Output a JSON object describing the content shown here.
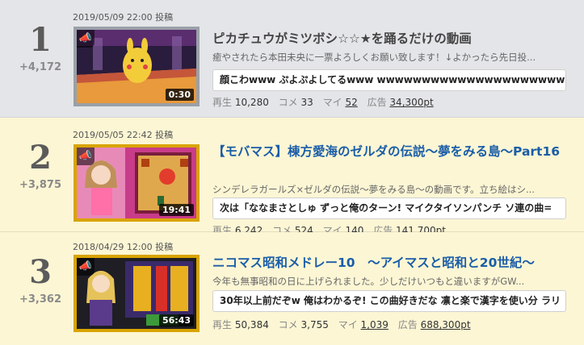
{
  "items": [
    {
      "rank": "1",
      "gain": "+4,172",
      "posted": "2019/05/09 22:00 投稿",
      "duration": "0:30",
      "title": "ピカチュウがミツボシ☆☆★を踊るだけの動画",
      "description": "癒やされたら本田未央に一票よろしくお願い致します！↓よかったら先日投...",
      "comment": "顔こわwww ぷよぷよしてるwww wwwwwwwwwwwwwwwwwwwwww",
      "stats": {
        "views_label": "再生",
        "views": "10,280",
        "comments_label": "コメ",
        "comments": "33",
        "mylist_label": "マイ",
        "mylist": "52",
        "ads_label": "広告",
        "ads": "34,300pt"
      }
    },
    {
      "rank": "2",
      "gain": "+3,875",
      "posted": "2019/05/05 22:42 投稿",
      "duration": "19:41",
      "title": "【モバマス】棟方愛海のゼルダの伝説～夢をみる島～Part16",
      "description": "シンデレラガールズ×ゼルダの伝説～夢をみる島～の動画です。立ち絵はシ...",
      "comment": "次は「ななまさとしゅ ずっと俺のターン! マイクタイソンパンチ ソ連の曲=",
      "stats": {
        "views_label": "再生",
        "views": "6,242",
        "comments_label": "コメ",
        "comments": "524",
        "mylist_label": "マイ",
        "mylist": "140",
        "ads_label": "広告",
        "ads": "141,700pt"
      }
    },
    {
      "rank": "3",
      "gain": "+3,362",
      "posted": "2018/04/29 12:00 投稿",
      "duration": "56:43",
      "title": "ニコマス昭和メドレー10　～アイマスと昭和と20世紀～",
      "description": "今年も無事昭和の日に上げられました。少しだけいつもと違いますがGW...",
      "comment": "30年以上前だぞw 俺はわかるぞ! この曲好きだな 凛と楽で漢字を使い分 ラリ",
      "stats": {
        "views_label": "再生",
        "views": "50,384",
        "comments_label": "コメ",
        "comments": "3,755",
        "mylist_label": "マイ",
        "mylist": "1,039",
        "ads_label": "広告",
        "ads": "688,300pt"
      }
    }
  ],
  "icons": {
    "badge": "megaphone-icon"
  },
  "colors": {
    "title_link": "#1a5da8",
    "gold_frame": "#d9a400",
    "silver_frame": "#9aa0a8"
  }
}
